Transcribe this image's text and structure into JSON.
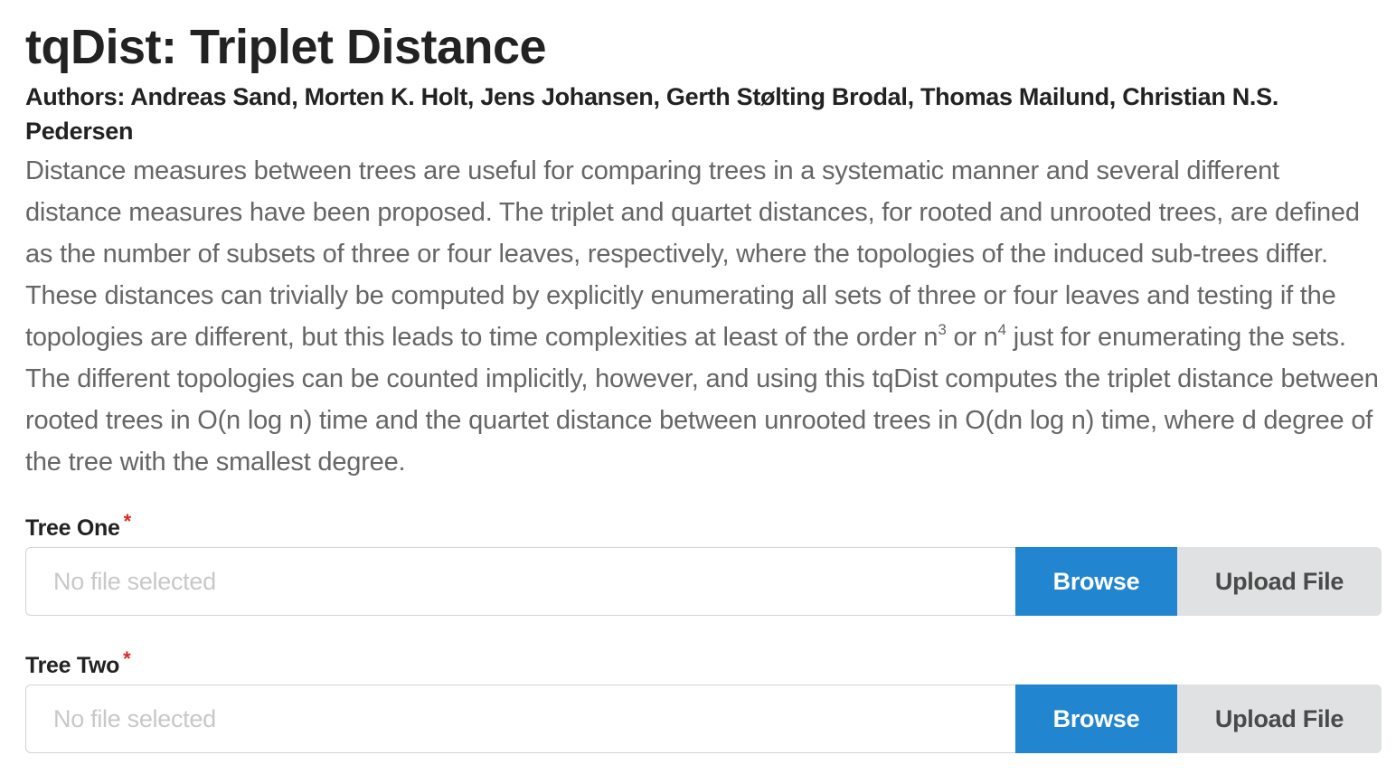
{
  "header": {
    "title": "tqDist: Triplet Distance",
    "authors": "Authors: Andreas Sand, Morten K. Holt, Jens Johansen, Gerth Stølting Brodal, Thomas Mailund, Christian N.S. Pedersen"
  },
  "description": {
    "part1": "Distance measures between trees are useful for comparing trees in a systematic manner and several different distance measures have been proposed. The triplet and quartet distances, for rooted and unrooted trees, are defined as the number of subsets of three or four leaves, respectively, where the topologies of the induced sub-trees differ. These distances can trivially be computed by explicitly enumerating all sets of three or four leaves and testing if the topologies are different, but this leads to time complexities at least of the order n",
    "sup1": "3",
    "part2": " or n",
    "sup2": "4",
    "part3": " just for enumerating the sets. The different topologies can be counted implicitly, however, and using this tqDist computes the triplet distance between rooted trees in O(n log n) time and the quartet distance between unrooted trees in O(dn log n) time, where d degree of the tree with the smallest degree."
  },
  "form": {
    "tree_one": {
      "label": "Tree One",
      "required_mark": "*",
      "placeholder": "No file selected",
      "browse_label": "Browse",
      "upload_label": "Upload File"
    },
    "tree_two": {
      "label": "Tree Two",
      "required_mark": "*",
      "placeholder": "No file selected",
      "browse_label": "Browse",
      "upload_label": "Upload File"
    }
  },
  "colors": {
    "primary_button": "#2185d0",
    "secondary_button": "#e0e1e2",
    "required": "#db2828",
    "description_text": "#666666"
  }
}
